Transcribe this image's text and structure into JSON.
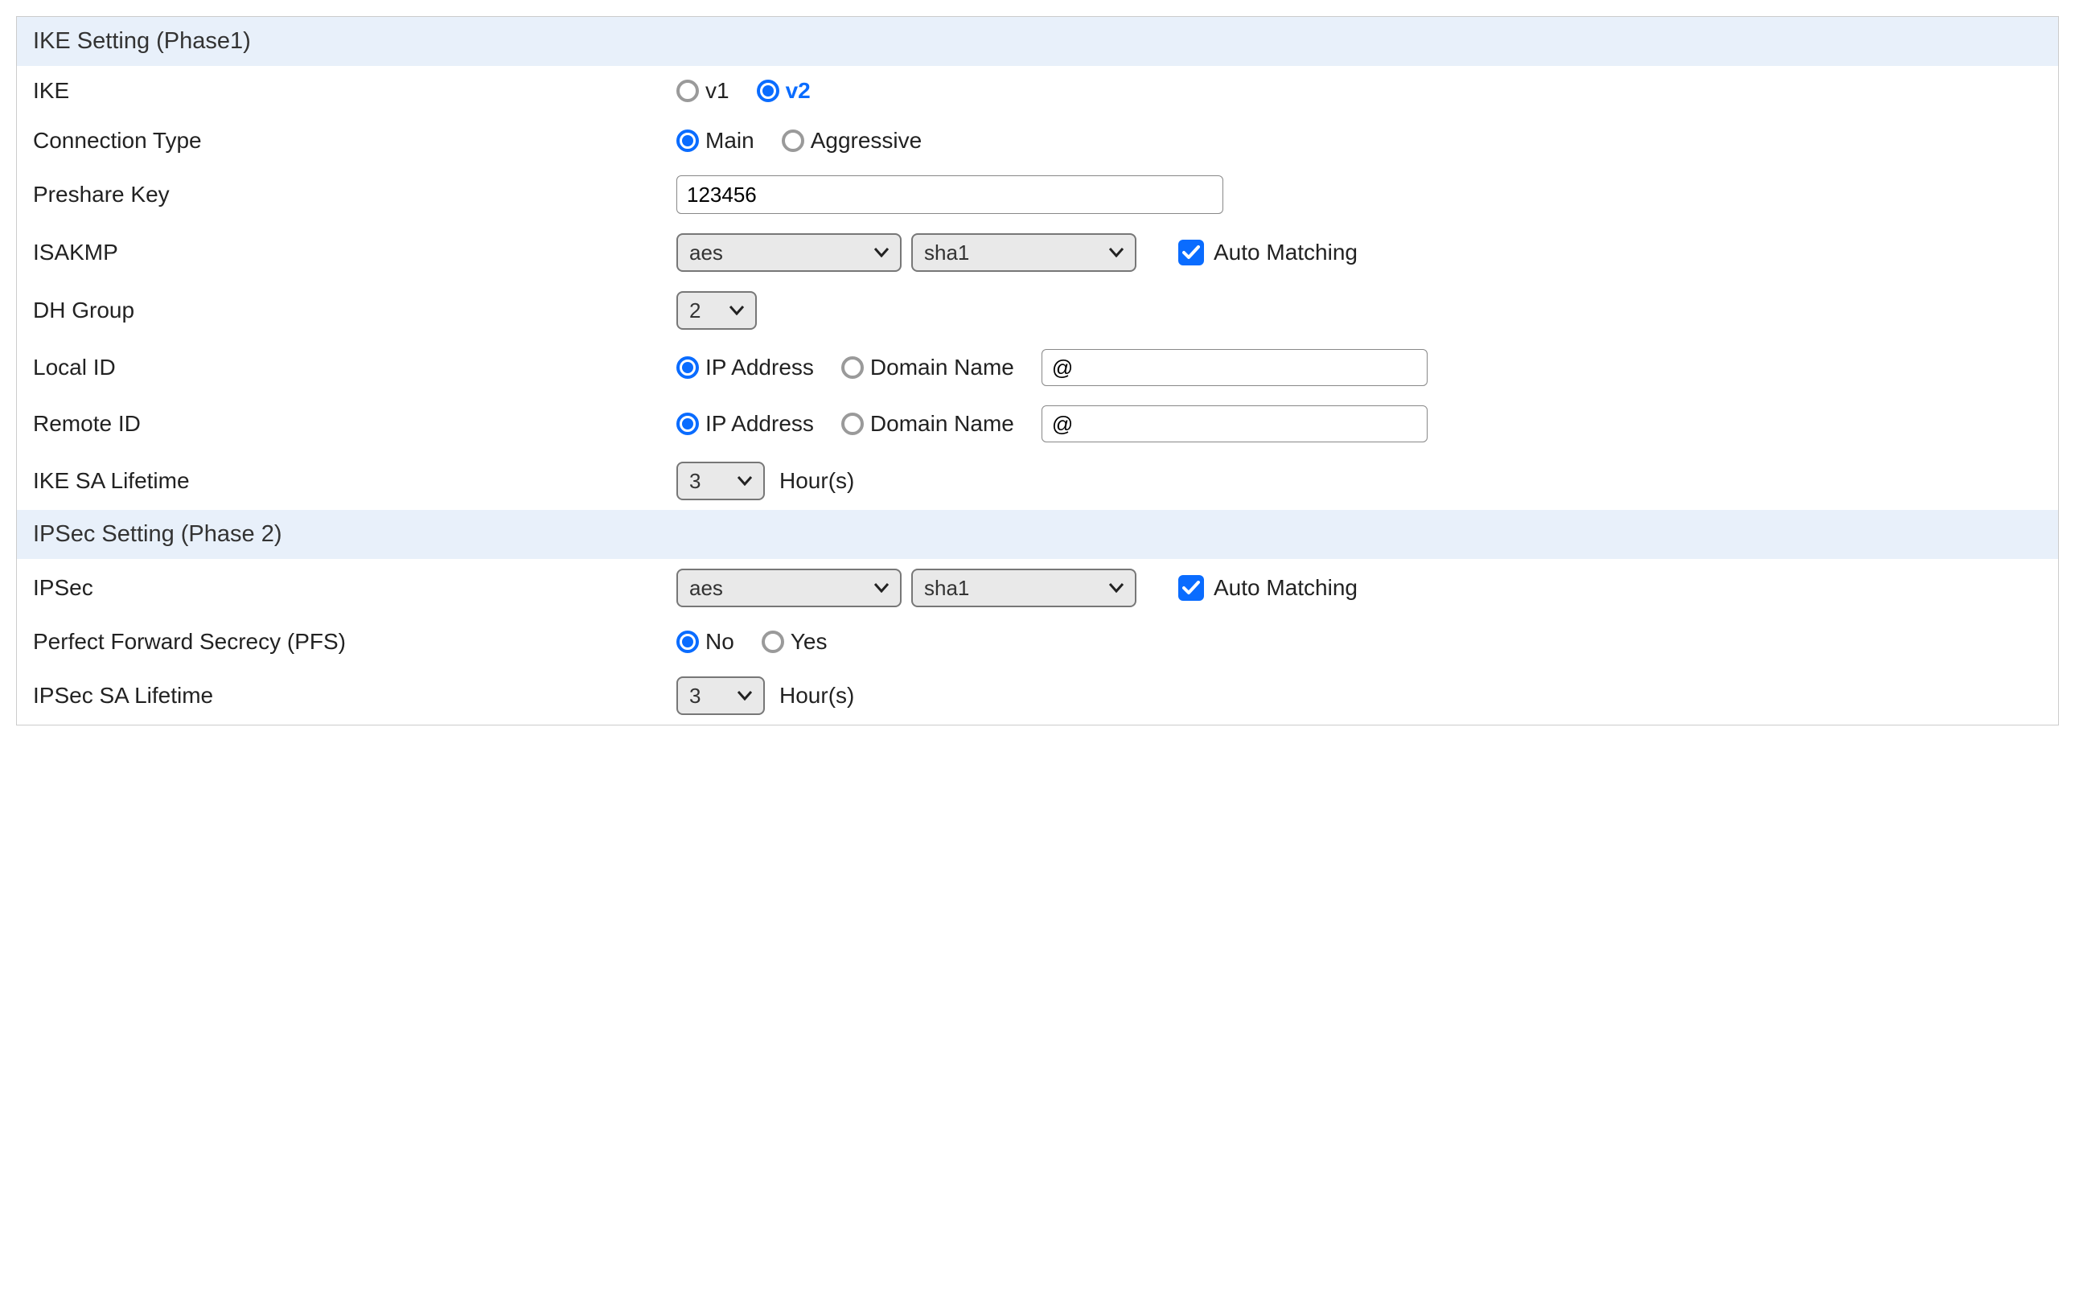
{
  "sections": {
    "ike_header": "IKE Setting (Phase1)",
    "ipsec_header": "IPSec Setting (Phase 2)"
  },
  "ike": {
    "label": "IKE",
    "v1": "v1",
    "v2": "v2",
    "selected": "v2"
  },
  "connection_type": {
    "label": "Connection Type",
    "main": "Main",
    "aggressive": "Aggressive",
    "selected": "Main"
  },
  "preshare_key": {
    "label": "Preshare Key",
    "value": "123456"
  },
  "isakmp": {
    "label": "ISAKMP",
    "enc": "aes",
    "hash": "sha1",
    "auto_matching_label": "Auto Matching",
    "auto_matching_checked": true
  },
  "dh_group": {
    "label": "DH Group",
    "value": "2"
  },
  "local_id": {
    "label": "Local ID",
    "ip": "IP Address",
    "domain": "Domain Name",
    "selected": "IP Address",
    "domain_value": "@"
  },
  "remote_id": {
    "label": "Remote ID",
    "ip": "IP Address",
    "domain": "Domain Name",
    "selected": "IP Address",
    "domain_value": "@"
  },
  "ike_sa_lifetime": {
    "label": "IKE SA Lifetime",
    "value": "3",
    "unit": "Hour(s)"
  },
  "ipsec": {
    "label": "IPSec",
    "enc": "aes",
    "hash": "sha1",
    "auto_matching_label": "Auto Matching",
    "auto_matching_checked": true
  },
  "pfs": {
    "label": "Perfect Forward Secrecy (PFS)",
    "no": "No",
    "yes": "Yes",
    "selected": "No"
  },
  "ipsec_sa_lifetime": {
    "label": "IPSec SA Lifetime",
    "value": "3",
    "unit": "Hour(s)"
  }
}
